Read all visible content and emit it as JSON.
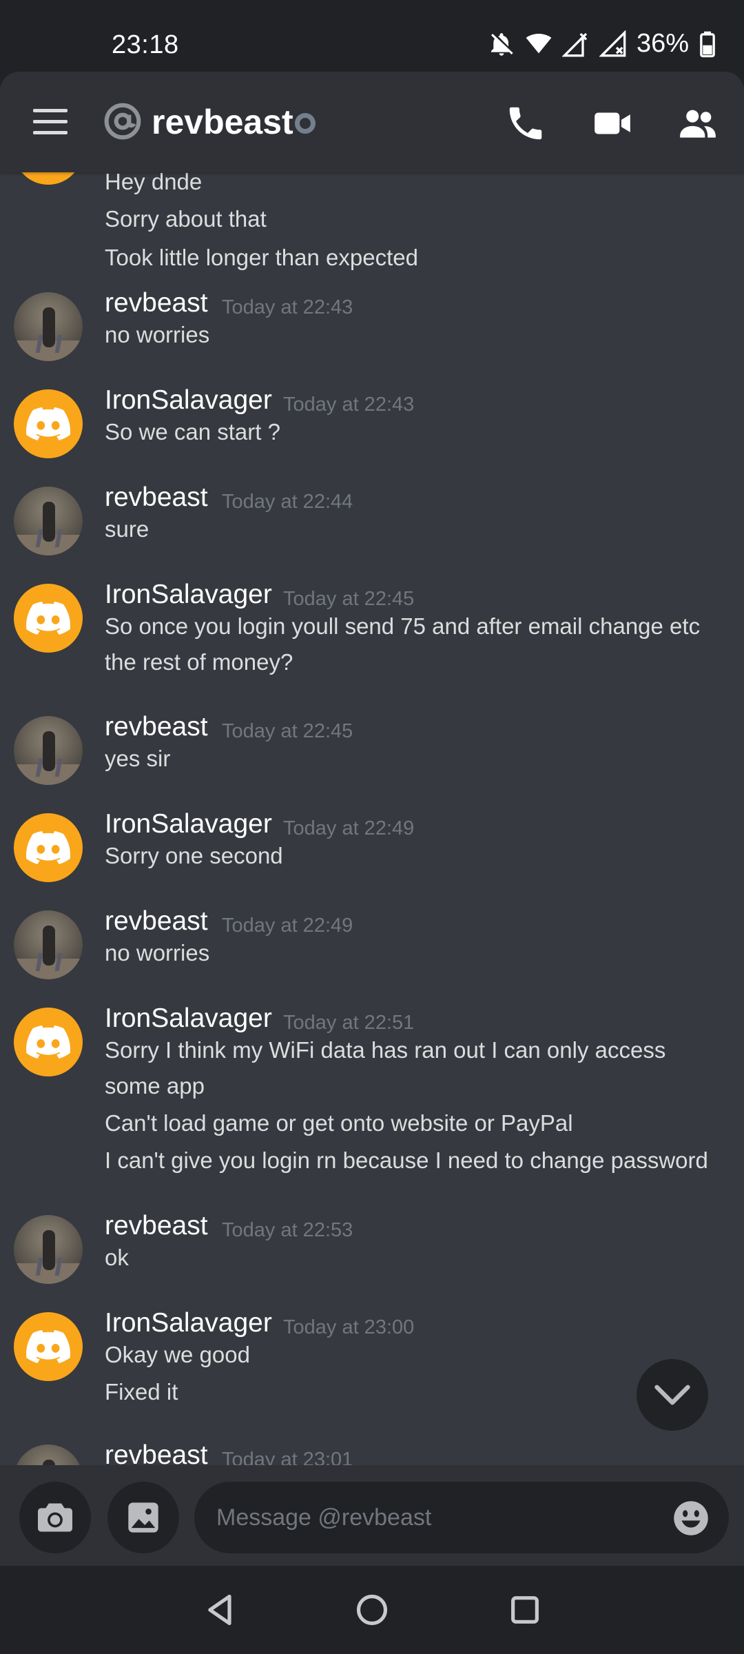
{
  "status_bar": {
    "time": "23:18",
    "battery": "36%"
  },
  "header": {
    "title": "revbeast"
  },
  "messages": {
    "top": {
      "line1": "Hey dnde",
      "line2": "Sorry about that",
      "line3": "Took little longer than expected"
    },
    "g1": {
      "user": "revbeast",
      "time": "Today at 22:43",
      "lines": [
        "no worries"
      ]
    },
    "g2": {
      "user": "IronSalavager",
      "time": "Today at 22:43",
      "lines": [
        "So we can start ?"
      ]
    },
    "g3": {
      "user": "revbeast",
      "time": "Today at 22:44",
      "lines": [
        "sure"
      ]
    },
    "g4": {
      "user": "IronSalavager",
      "time": "Today at 22:45",
      "lines": [
        "So once you login youll send 75 and after email change etc",
        "the rest of money?"
      ]
    },
    "g5": {
      "user": "revbeast",
      "time": "Today at 22:45",
      "lines": [
        "yes sir"
      ]
    },
    "g6": {
      "user": "IronSalavager",
      "time": "Today at 22:49",
      "lines": [
        "Sorry one second"
      ]
    },
    "g7": {
      "user": "revbeast",
      "time": "Today at 22:49",
      "lines": [
        "no worries"
      ]
    },
    "g8": {
      "user": "IronSalavager",
      "time": "Today at 22:51",
      "lines": [
        "Sorry I think my WiFi data has ran out I can only access",
        "some app",
        "Can't load game or get onto website or PayPal",
        "I can't give you login rn because I need to change password"
      ]
    },
    "g9": {
      "user": "revbeast",
      "time": "Today at 22:53",
      "lines": [
        "ok"
      ]
    },
    "g10": {
      "user": "IronSalavager",
      "time": "Today at 23:00",
      "lines": [
        "Okay we good",
        "Fixed it"
      ]
    },
    "g11": {
      "user": "revbeast",
      "time": "Today at 23:01"
    }
  },
  "composer": {
    "placeholder": "Message @revbeast"
  },
  "colors": {
    "background": "#36393f",
    "header": "#2f3136",
    "avatar_discord": "#faa61a",
    "timestamp": "#72767d"
  }
}
